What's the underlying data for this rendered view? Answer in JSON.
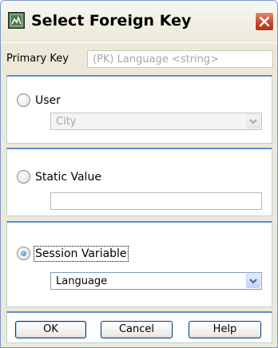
{
  "window": {
    "title": "Select Foreign Key"
  },
  "primary_key": {
    "label": "Primary Key",
    "value": "(PK) Language <string>"
  },
  "options": {
    "user": {
      "label": "User",
      "selected": false,
      "dropdown_value": "City",
      "dropdown_enabled": false
    },
    "static_value": {
      "label": "Static Value",
      "selected": false,
      "input_value": ""
    },
    "session_variable": {
      "label": "Session Variable",
      "selected": true,
      "dropdown_value": "Language",
      "dropdown_enabled": true
    }
  },
  "buttons": {
    "ok_label": "OK",
    "cancel_label": "Cancel",
    "help_label": "Help"
  },
  "icons": {
    "app": "window-app-icon",
    "close": "close-icon",
    "dropdown": "chevron-down-icon"
  },
  "colors": {
    "window_bg": "#ece9d8",
    "group_border_accent": "#5b8dd3",
    "close_button": "#c4442b",
    "radio_selected": "#2a7fd4"
  }
}
